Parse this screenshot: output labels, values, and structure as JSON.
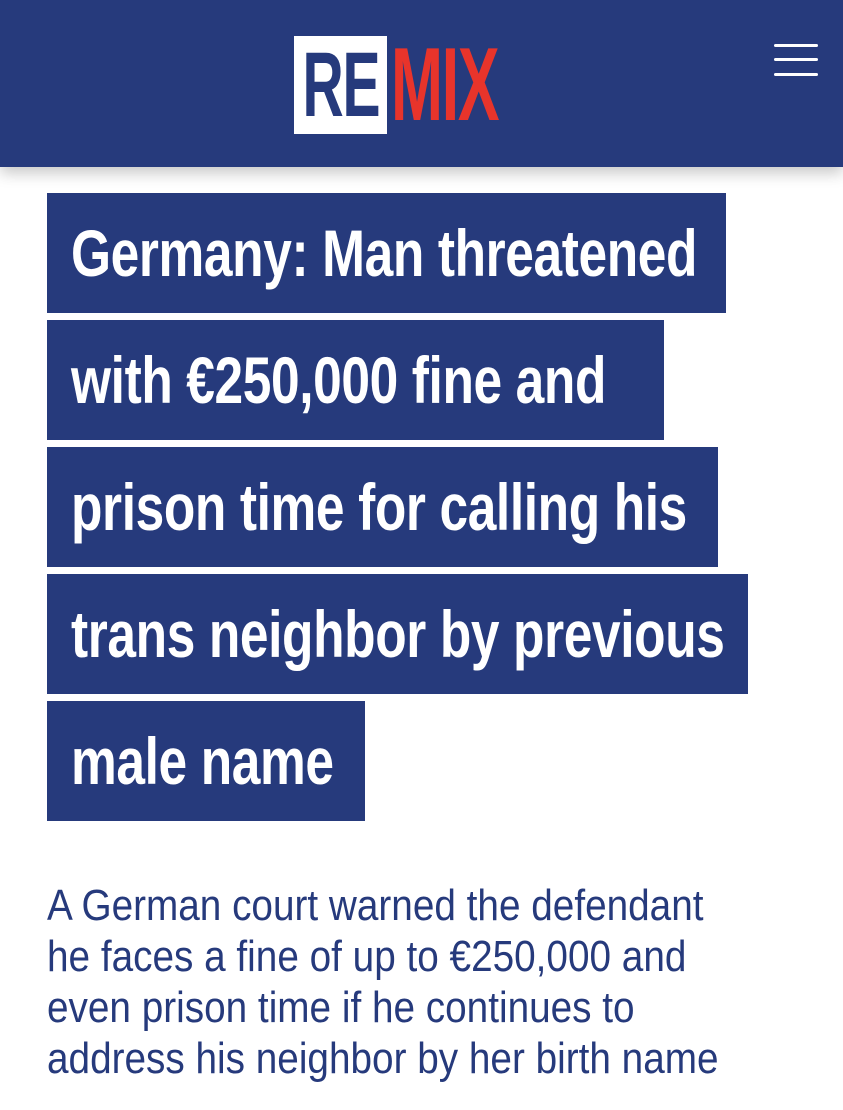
{
  "header": {
    "logo_left": "RE",
    "logo_right": "MIX",
    "menu_icon": "hamburger-menu-icon",
    "colors": {
      "background": "#263a7c",
      "logo_red": "#e8342b",
      "logo_white": "#ffffff"
    }
  },
  "article": {
    "headline_lines": [
      "Germany: Man threatened",
      "with €250,000 fine and",
      "prison time for calling his",
      "trans neighbor by previous",
      "male name"
    ],
    "lead_lines": [
      "A German court warned the defendant",
      "he faces a fine of up to €250,000 and",
      "even prison time if he continues to",
      "address his neighbor by her birth name"
    ]
  }
}
